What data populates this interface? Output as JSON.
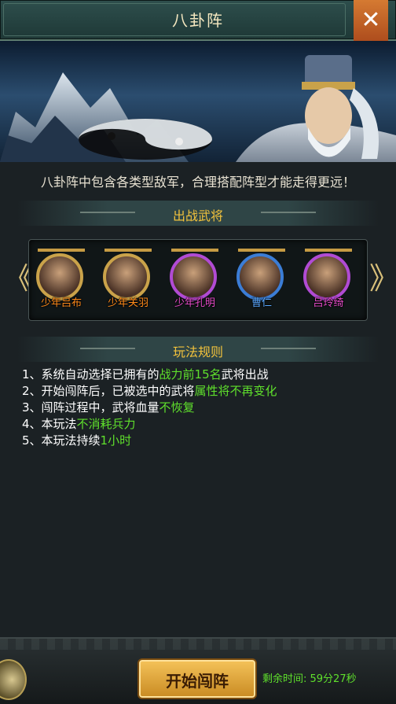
{
  "window": {
    "title": "八卦阵",
    "close_label": "✕"
  },
  "intro_text": "八卦阵中包含各类型敌军，合理搭配阵型才能走得更远！",
  "heroes_section": {
    "title": "出战武将",
    "prev_arrow": "《",
    "next_arrow": "》",
    "heroes": [
      {
        "name": "少年吕布",
        "quality": "orange"
      },
      {
        "name": "少年关羽",
        "quality": "orange"
      },
      {
        "name": "少年孔明",
        "quality": "purple"
      },
      {
        "name": "曹仁",
        "quality": "blue"
      },
      {
        "name": "吕玲绮",
        "quality": "purple"
      }
    ]
  },
  "rules_section": {
    "title": "玩法规则",
    "rules": [
      {
        "prefix": "1、系统自动选择已拥有的",
        "highlight": "战力前15名",
        "suffix": "武将出战"
      },
      {
        "prefix": "2、开始闯阵后，已被选中的武将",
        "highlight": "属性将不再变化",
        "suffix": ""
      },
      {
        "prefix": "3、闯阵过程中，武将血量",
        "highlight": "不恢复",
        "suffix": ""
      },
      {
        "prefix": "4、本玩法",
        "highlight": "不消耗兵力",
        "suffix": ""
      },
      {
        "prefix": "5、本玩法持续",
        "highlight": "1小时",
        "suffix": ""
      }
    ]
  },
  "footer": {
    "start_button": "开始闯阵",
    "timer_text": "剩余时间: 59分27秒"
  },
  "colors": {
    "accent_gold": "#f2c23c",
    "highlight_green": "#5fe02c",
    "close_orange": "#d57a32"
  }
}
